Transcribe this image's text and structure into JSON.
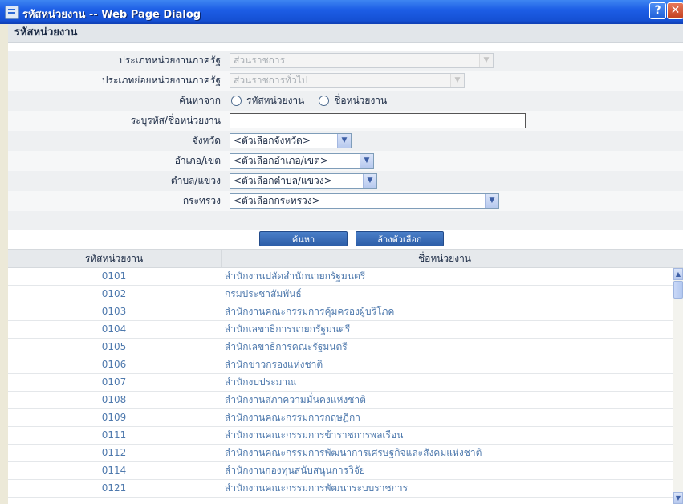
{
  "window": {
    "title": "รหัสหน่วยงาน -- Web Page Dialog",
    "help_label": "?",
    "close_label": "✕"
  },
  "section_title": "รหัสหน่วยงาน",
  "form": {
    "agency_type": {
      "label": "ประเภทหน่วยงานภาครัฐ",
      "value": "ส่วนราชการ"
    },
    "agency_subtype": {
      "label": "ประเภทย่อยหน่วยงานภาครัฐ",
      "value": "ส่วนราชการทั่วไป"
    },
    "search_by": {
      "label": "ค้นหาจาก",
      "option_code": "รหัสหน่วยงาน",
      "option_name": "ชื่อหน่วยงาน"
    },
    "keyword": {
      "label": "ระบุรหัส/ชื่อหน่วยงาน",
      "value": ""
    },
    "province": {
      "label": "จังหวัด",
      "value": "<ตัวเลือกจังหวัด>"
    },
    "district": {
      "label": "อำเภอ/เขต",
      "value": "<ตัวเลือกอำเภอ/เขต>"
    },
    "subdistrict": {
      "label": "ตำบล/แขวง",
      "value": "<ตัวเลือกตำบล/แขวง>"
    },
    "ministry": {
      "label": "กระทรวง",
      "value": "<ตัวเลือกกระทรวง>"
    }
  },
  "buttons": {
    "search": "ค้นหา",
    "clear": "ล้างตัวเลือก"
  },
  "table": {
    "columns": [
      "รหัสหน่วยงาน",
      "ชื่อหน่วยงาน"
    ],
    "rows": [
      {
        "code": "0101",
        "name": "สำนักงานปลัดสำนักนายกรัฐมนตรี"
      },
      {
        "code": "0102",
        "name": "กรมประชาสัมพันธ์"
      },
      {
        "code": "0103",
        "name": "สำนักงานคณะกรรมการคุ้มครองผู้บริโภค"
      },
      {
        "code": "0104",
        "name": "สำนักเลขาธิการนายกรัฐมนตรี"
      },
      {
        "code": "0105",
        "name": "สำนักเลขาธิการคณะรัฐมนตรี"
      },
      {
        "code": "0106",
        "name": "สำนักข่าวกรองแห่งชาติ"
      },
      {
        "code": "0107",
        "name": "สำนักงบประมาณ"
      },
      {
        "code": "0108",
        "name": "สำนักงานสภาความมั่นคงแห่งชาติ"
      },
      {
        "code": "0109",
        "name": "สำนักงานคณะกรรมการกฤษฎีกา"
      },
      {
        "code": "0111",
        "name": "สำนักงานคณะกรรมการข้าราชการพลเรือน"
      },
      {
        "code": "0112",
        "name": "สำนักงานคณะกรรมการพัฒนาการเศรษฐกิจและสังคมแห่งชาติ"
      },
      {
        "code": "0114",
        "name": "สำนักงานกองทุนสนับสนุนการวิจัย"
      },
      {
        "code": "0121",
        "name": "สำนักงานคณะกรรมการพัฒนาระบบราชการ"
      }
    ]
  }
}
